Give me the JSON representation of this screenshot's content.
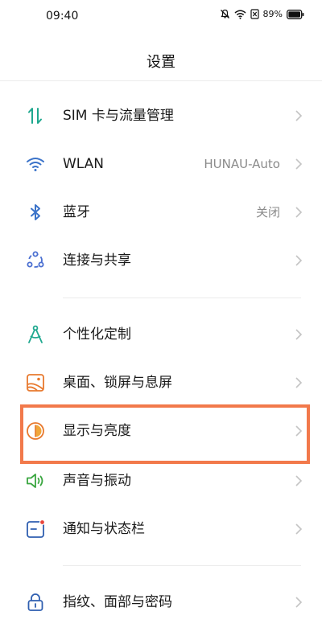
{
  "status": {
    "time": "09:40",
    "battery": "89%",
    "icons": [
      "mute-bell-icon",
      "wifi-icon",
      "sim-off-icon",
      "battery-icon"
    ]
  },
  "header": {
    "title": "设置"
  },
  "items": [
    {
      "id": "sim",
      "label": "SIM 卡与流量管理",
      "value": "",
      "icon": "sim-data-icon"
    },
    {
      "id": "wlan",
      "label": "WLAN",
      "value": "HUNAU-Auto",
      "icon": "wifi-icon"
    },
    {
      "id": "bluetooth",
      "label": "蓝牙",
      "value": "关闭",
      "icon": "bluetooth-icon"
    },
    {
      "id": "connection",
      "label": "连接与共享",
      "value": "",
      "icon": "share-nodes-icon"
    },
    {
      "id": "personalize",
      "label": "个性化定制",
      "value": "",
      "icon": "compass-icon"
    },
    {
      "id": "desktop",
      "label": "桌面、锁屏与息屏",
      "value": "",
      "icon": "wallpaper-icon"
    },
    {
      "id": "display",
      "label": "显示与亮度",
      "value": "",
      "icon": "brightness-icon"
    },
    {
      "id": "sound",
      "label": "声音与振动",
      "value": "",
      "icon": "speaker-icon"
    },
    {
      "id": "notification",
      "label": "通知与状态栏",
      "value": "",
      "icon": "notification-icon"
    },
    {
      "id": "security",
      "label": "指纹、面部与密码",
      "value": "",
      "icon": "lock-icon"
    }
  ],
  "colors": {
    "highlight": "#f2794b",
    "sim": "#1fa88f",
    "wlan": "#3b73c9",
    "bluetooth": "#3b73c9",
    "connection": "#4a6fd1",
    "personalize": "#1fa88f",
    "desktop": "#e8792e",
    "display": "#e8792e",
    "sound": "#3aa640",
    "notification": "#2f5fb0",
    "security": "#2f5fb0"
  }
}
